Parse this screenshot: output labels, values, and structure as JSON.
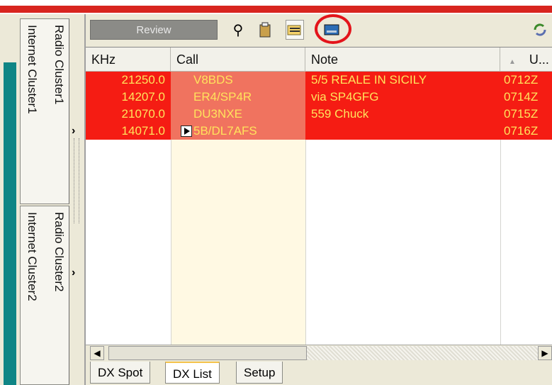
{
  "sidebar": {
    "tabs": [
      {
        "line1": "Radio Cluster1",
        "line2": "Internet Cluster1"
      },
      {
        "line1": "Radio Cluster2",
        "line2": "Internet Cluster2"
      }
    ]
  },
  "toolbar": {
    "review_label": "Review",
    "icons": [
      "search-icon",
      "paste-icon",
      "folder-icon",
      "display-icon",
      "refresh-icon"
    ]
  },
  "grid": {
    "columns": [
      "KHz",
      "Call",
      "Note",
      "U..."
    ],
    "rows": [
      {
        "khz": "21250.0",
        "call": "V8BDS",
        "note": "5/5 REALE IN SICILY",
        "utc": "0712Z"
      },
      {
        "khz": "14207.0",
        "call": "ER4/SP4R",
        "note": "via SP4GFG",
        "utc": "0714Z"
      },
      {
        "khz": "21070.0",
        "call": "DU3NXE",
        "note": "559 Chuck",
        "utc": "0715Z"
      },
      {
        "khz": "14071.0",
        "call": "5B/DL7AFS",
        "note": "",
        "utc": "0716Z"
      }
    ]
  },
  "bottom_tabs": [
    "DX Spot",
    "DX List",
    "Setup"
  ],
  "active_bottom_tab": "DX List",
  "colors": {
    "row_bg": "#f51c13",
    "call_bg": "#f0735f",
    "text": "#ffe35c",
    "highlight": "#e3141b"
  }
}
